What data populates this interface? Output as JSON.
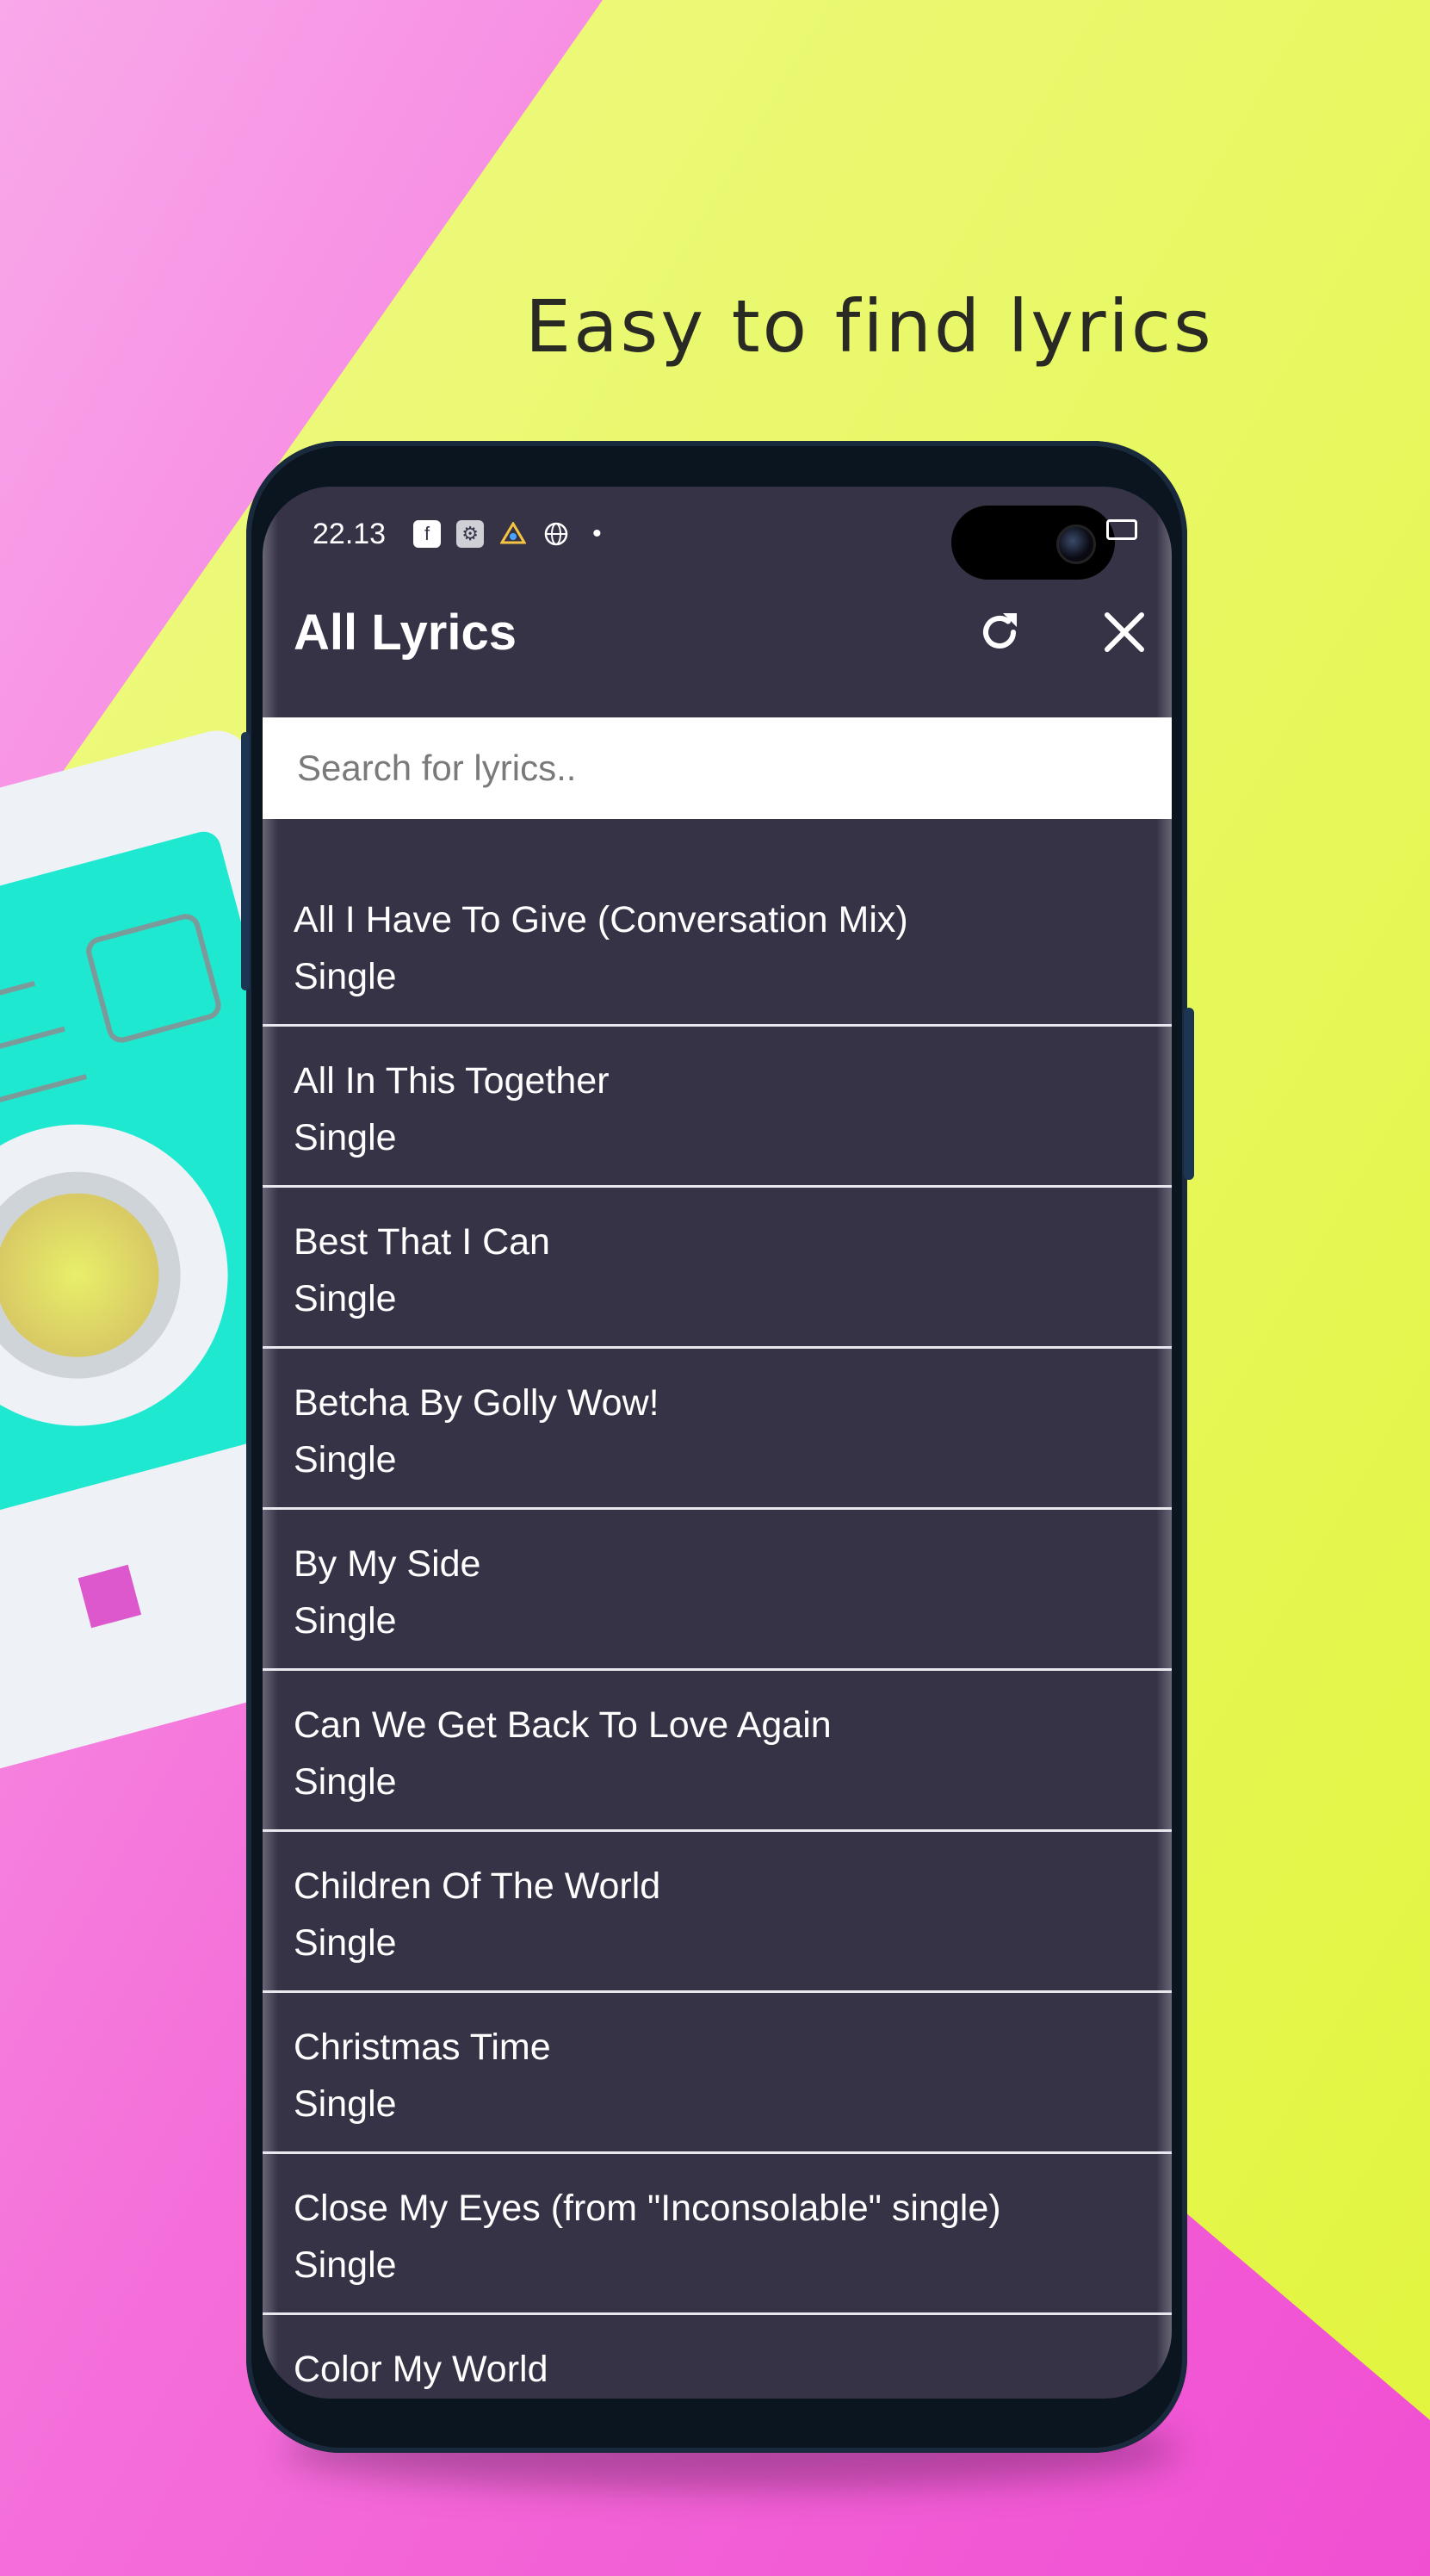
{
  "colors": {
    "background_pink": "#f45fd8",
    "background_yellow": "#e8f553",
    "screen": "#363347",
    "cassette_teal": "#1ee8cf",
    "cassette_white": "#eef2f6"
  },
  "promo": {
    "tagline": "Easy to find lyrics"
  },
  "status_bar": {
    "time": "22.13",
    "icons": [
      "facebook-icon",
      "settings-app-icon",
      "drive-icon",
      "globe-icon",
      "dot-icon"
    ]
  },
  "app_bar": {
    "title": "All Lyrics",
    "refresh_icon": "refresh-icon",
    "close_icon": "close-icon"
  },
  "search": {
    "placeholder": "Search for lyrics..",
    "value": ""
  },
  "songs": [
    {
      "title": "All I Have To Give (Conversation Mix)",
      "type": "Single"
    },
    {
      "title": "All In This Together",
      "type": "Single"
    },
    {
      "title": "Best That I Can",
      "type": "Single"
    },
    {
      "title": "Betcha By Golly Wow!",
      "type": "Single"
    },
    {
      "title": "By My Side",
      "type": "Single"
    },
    {
      "title": "Can We Get Back To Love Again",
      "type": "Single"
    },
    {
      "title": "Children Of The World",
      "type": "Single"
    },
    {
      "title": "Christmas Time",
      "type": "Single"
    },
    {
      "title": "Close My Eyes (from \"Inconsolable\" single)",
      "type": "Single"
    },
    {
      "title": "Color My World",
      "type": ""
    }
  ]
}
